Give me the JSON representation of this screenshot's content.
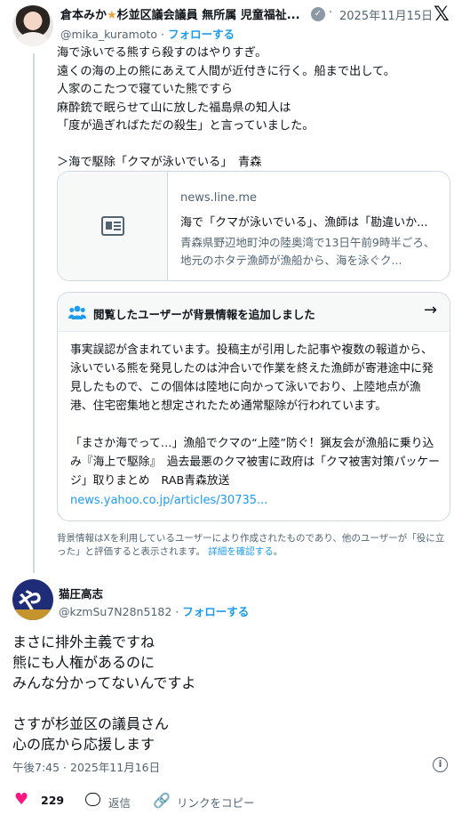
{
  "tweet": {
    "author_name": "倉本みか",
    "author_title": "杉並区議会議員 無所属 児童福祉...",
    "date_separator": "·",
    "date": "2025年11月15日",
    "handle": "@mika_kuramoto",
    "handle_separator": "·",
    "follow_label": "フォローする",
    "text": "海で泳いでる熊すら殺すのはやりすぎ。\n遠くの海の上の熊にあえて人間が近付きに行く。船まで出して。\n人家のこたつで寝ていた熊ですら\n麻酔銃で眠らせて山に放した福島県の知人は\n「度が過ぎればただの殺生」と言っていました。\n\n＞海で駆除「クマが泳いでいる」　青森"
  },
  "link_card": {
    "domain": "news.line.me",
    "title": "海で「クマが泳いでいる」、漁師は「勘違いか...",
    "description": "青森県野辺地町沖の陸奥湾で13日午前9時半ごろ、地元のホタテ漁師が漁船から、海を泳ぐク..."
  },
  "community_note": {
    "header": "閲覧したユーザーが背景情報を追加しました",
    "body_1": "事実誤認が含まれています。投稿主が引用した記事や複数の報道から、泳いでいる熊を発見したのは沖合いで作業を終えた漁師が寄港途中に発見したもので、この個体は陸地に向かって泳いでおり、上陸地点が漁港、住宅密集地と想定されたため通常駆除が行われています。",
    "body_2": "「まさか海でって…」漁船でクマの“上陸”防ぐ！猟友会が漁船に乗り込み『海上で駆除』　過去最悪のクマ被害に政府は「クマ被害対策パッケージ」取りまとめ　RAB青森放送",
    "link": "news.yahoo.co.jp/articles/30735...",
    "footer": "背景情報はXを利用しているユーザーにより作成されたものであり、他のユーザーが「役に立った」と評価すると表示されます。",
    "footer_link": "詳細を確認する",
    "footer_end": "。"
  },
  "reply": {
    "author_name": "猫圧高志",
    "handle": "@kzmSu7N28n5182",
    "handle_separator": "·",
    "follow_label": "フォローする",
    "text": "まさに排外主義ですね\n熊にも人権があるのに\nみんな分かってないんですよ\n\nさすが杉並区の議員さん\n心の底から応援します",
    "timestamp": "午後7:45 · 2025年11月16日"
  },
  "actions": {
    "likes": "229",
    "reply_label": "返信",
    "copy_label": "リンクをコピー"
  },
  "icons": {
    "star": "star-emoji",
    "verified": "verified-badge",
    "x_logo": "x-logo",
    "news": "newspaper-icon",
    "people": "people-icon",
    "arrow": "arrow-right-icon",
    "info": "info-icon",
    "heart": "heart-icon",
    "reply": "reply-icon",
    "link": "link-icon"
  },
  "colors": {
    "accent": "#1d9bf0",
    "like": "#f91880",
    "muted": "#536471",
    "border": "#cfd9de"
  }
}
